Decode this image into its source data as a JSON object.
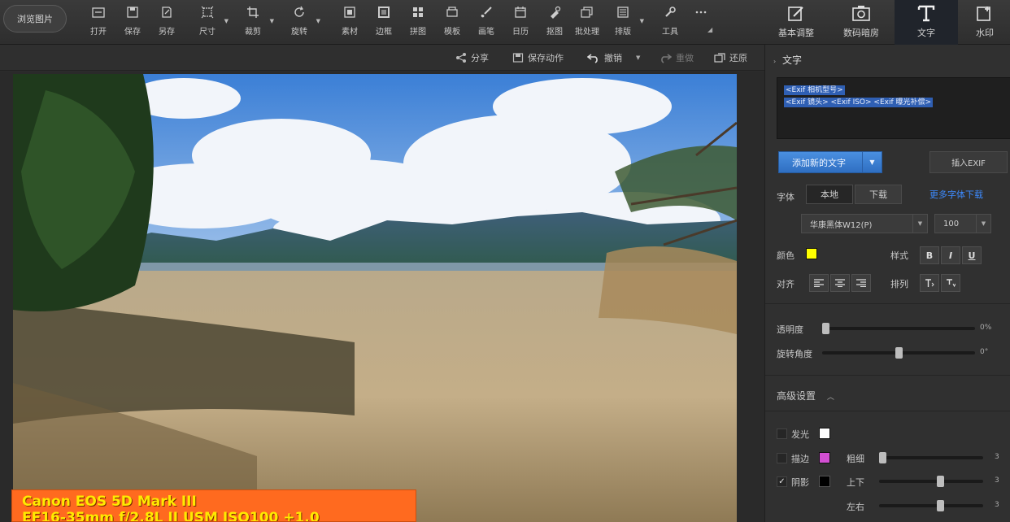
{
  "topbar": {
    "browse_label": "浏览图片",
    "tools": [
      {
        "label": "打开",
        "icon": "open-icon"
      },
      {
        "label": "保存",
        "icon": "save-icon"
      },
      {
        "label": "另存",
        "icon": "save-as-icon"
      },
      {
        "label": "尺寸",
        "icon": "resize-icon"
      },
      {
        "label": "裁剪",
        "icon": "crop-icon"
      },
      {
        "label": "旋转",
        "icon": "rotate-icon"
      },
      {
        "label": "素材",
        "icon": "material-icon"
      },
      {
        "label": "边框",
        "icon": "border-icon"
      },
      {
        "label": "拼图",
        "icon": "collage-icon"
      },
      {
        "label": "模板",
        "icon": "template-icon"
      },
      {
        "label": "画笔",
        "icon": "brush-icon"
      },
      {
        "label": "日历",
        "icon": "calendar-icon"
      },
      {
        "label": "抠图",
        "icon": "cutout-icon"
      },
      {
        "label": "批处理",
        "icon": "batch-icon"
      },
      {
        "label": "排版",
        "icon": "layout-icon"
      },
      {
        "label": "工具",
        "icon": "wrench-icon"
      },
      {
        "label": "···",
        "icon": "more-icon"
      }
    ],
    "right_tabs": [
      {
        "label": "基本调整",
        "icon": "adjust-icon"
      },
      {
        "label": "数码暗房",
        "icon": "darkroom-icon"
      },
      {
        "label": "文字",
        "icon": "text-icon"
      },
      {
        "label": "水印",
        "icon": "watermark-icon"
      }
    ]
  },
  "subbar": {
    "share": "分享",
    "save_action": "保存动作",
    "undo": "撤销",
    "redo": "重做",
    "restore": "还原"
  },
  "overlay": {
    "line1": "Canon EOS 5D Mark III",
    "line2": "EF16-35mm f/2.8L II USM ISO100 +1.0"
  },
  "panel": {
    "title": "文字",
    "text_line1": "<Exif 相机型号>",
    "text_line2": "<Exif 镜头> <Exif ISO> <Exif 曝光补偿>",
    "add_text_btn": "添加新的文字",
    "insert_exif_btn": "插入EXIF",
    "font_label": "字体",
    "font_local": "本地",
    "font_download": "下载",
    "more_fonts_link": "更多字体下载",
    "font_name": "华康黑体W12(P)",
    "font_size": "100",
    "color_label": "颜色",
    "style_label": "样式",
    "style_bold": "B",
    "style_italic": "I",
    "style_underline": "U",
    "align_label": "对齐",
    "arrange_label": "排列",
    "opacity_label": "透明度",
    "opacity_value": "0%",
    "opacity": 0,
    "rotation_label": "旋转角度",
    "rotation_value": "0°",
    "rotation": 0.5,
    "advanced_label": "高级设置",
    "glow_label": "发光",
    "stroke_label": "描边",
    "thickness_label": "粗细",
    "thickness_value": "3",
    "thickness": 0,
    "shadow_label": "阴影",
    "shadow_checked": "✓",
    "updown_label": "上下",
    "updown_value": "3",
    "updown": 0.6,
    "leftright_label": "左右",
    "leftright_value": "3",
    "leftright": 0.6,
    "colors": {
      "text": "#ffff00",
      "glow": "#ffffff",
      "stroke": "#d24fd2",
      "shadow": "#000000"
    }
  }
}
